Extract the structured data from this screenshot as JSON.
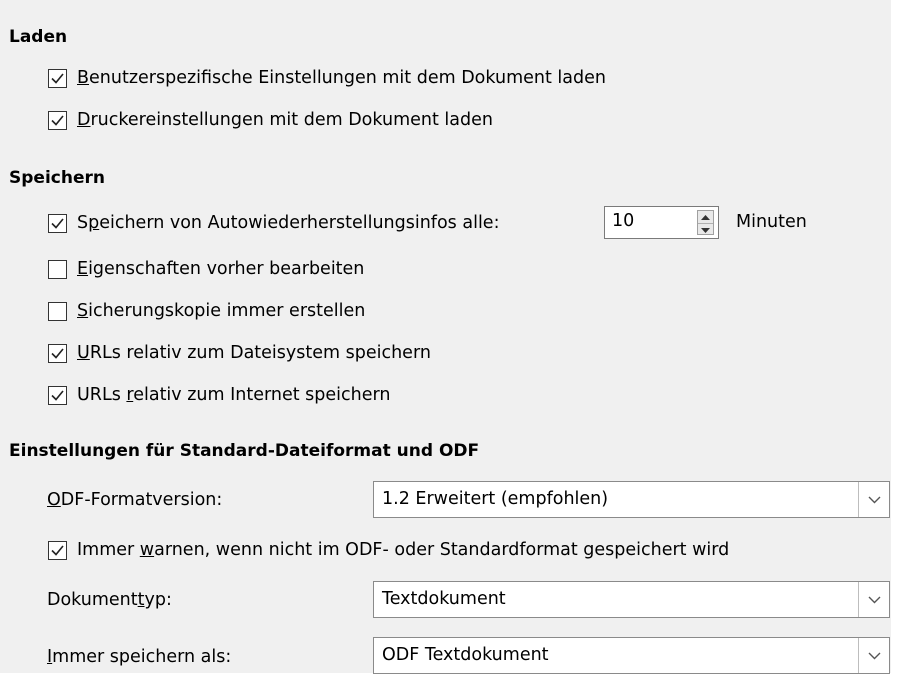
{
  "sections": {
    "load": {
      "heading": "Laden",
      "options": [
        {
          "label_parts": [
            "",
            "B",
            "enutzerspezifische Einstellungen mit dem Dokument laden"
          ],
          "checked": true
        },
        {
          "label_parts": [
            "",
            "D",
            "ruckereinstellungen mit dem Dokument laden"
          ],
          "checked": true
        }
      ]
    },
    "save": {
      "heading": "Speichern",
      "autosave": {
        "label_parts": [
          "S",
          "p",
          "eichern von Autowiederherstellungsinfos alle:"
        ],
        "checked": true,
        "value": "10",
        "unit": "Minuten"
      },
      "options": [
        {
          "label_parts": [
            "",
            "E",
            "igenschaften vorher bearbeiten"
          ],
          "checked": false
        },
        {
          "label_parts": [
            "",
            "S",
            "icherungskopie immer erstellen"
          ],
          "checked": false
        },
        {
          "label_parts": [
            "",
            "U",
            "RLs relativ zum Dateisystem speichern"
          ],
          "checked": true
        },
        {
          "label_parts": [
            "URLs ",
            "r",
            "elativ zum Internet speichern"
          ],
          "checked": true
        }
      ]
    },
    "format": {
      "heading": "Einstellungen für Standard-Dateiformat und ODF",
      "odf_version": {
        "label_parts": [
          "",
          "O",
          "DF-Formatversion:"
        ],
        "value": "1.2 Erweitert (empfohlen)"
      },
      "warn": {
        "label_parts": [
          "Immer ",
          "w",
          "arnen, wenn nicht im ODF- oder Standardformat gespeichert wird"
        ],
        "checked": true
      },
      "doc_type": {
        "label_parts": [
          "Dokument",
          "t",
          "yp:"
        ],
        "value": "Textdokument"
      },
      "save_as": {
        "label_parts": [
          "",
          "I",
          "mmer speichern als:"
        ],
        "value": "ODF Textdokument"
      }
    }
  },
  "icons": {
    "check": "checkmark-icon",
    "spin_up": "spin-up-icon",
    "spin_down": "spin-down-icon",
    "dropdown": "chevron-down-icon"
  },
  "colors": {
    "panel_bg": "#f0f0f0",
    "field_border": "#8a8a8a",
    "check_mark": "#222222"
  }
}
